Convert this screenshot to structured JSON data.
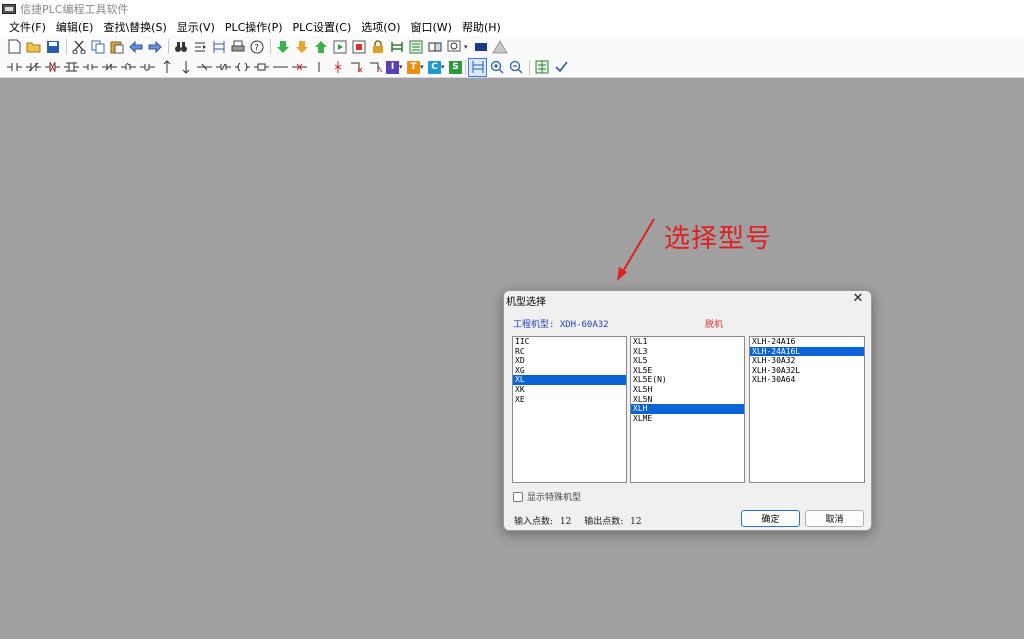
{
  "app": {
    "title": "信捷PLC编程工具软件"
  },
  "menu": {
    "items": [
      "文件(F)",
      "编辑(E)",
      "查找\\替换(S)",
      "显示(V)",
      "PLC操作(P)",
      "PLC设置(C)",
      "选项(O)",
      "窗口(W)",
      "帮助(H)"
    ]
  },
  "toolbar1": {
    "icons": [
      "new-file",
      "open-folder",
      "save",
      "cut",
      "copy",
      "paste",
      "undo-arrow",
      "redo-arrow",
      "binoculars",
      "replace",
      "ladder-table",
      "printer",
      "help",
      "download",
      "upload",
      "arrow-up",
      "run",
      "stop",
      "lock",
      "monitor",
      "sheet",
      "compare",
      "zoom-select",
      "screen",
      "warning"
    ]
  },
  "toolbar2": {
    "icons": [
      "contact-no",
      "contact-nc",
      "contact-neg",
      "contact-pos",
      "parallel-no",
      "parallel-nc",
      "parallel-pos",
      "parallel-neg",
      "arrow-up",
      "arrow-down",
      "horizontal-line",
      "contact-rising",
      "contact-falling",
      "coil-set",
      "coil",
      "line",
      "coil-neg",
      "vertical-line",
      "delete-line",
      "delete-branch",
      "insert-branch",
      "I",
      "T",
      "C",
      "S",
      "ladder-view",
      "zoom-in",
      "zoom-out",
      "monitor-table",
      "check"
    ],
    "box_letters": {
      "I": "I",
      "T": "T",
      "C": "C",
      "S": "S"
    }
  },
  "annotation": {
    "text": "选择型号"
  },
  "dialog": {
    "title": "机型选择",
    "close": "✕",
    "project_model_label": "工程机型:  XDH-60A32",
    "status": "脱机",
    "series": [
      "IIC",
      "RC",
      "XD",
      "XG",
      "XL",
      "XK",
      "XE"
    ],
    "series_selected": 4,
    "subseries": [
      "XL1",
      "XL3",
      "XL5",
      "XL5E",
      "XL5E(N)",
      "XL5H",
      "XL5N",
      "XLH",
      "XLME"
    ],
    "subseries_selected": 7,
    "models": [
      "XLH-24A16",
      "XLH-24A16L",
      "XLH-30A32",
      "XLH-30A32L",
      "XLH-30A64"
    ],
    "models_selected": 1,
    "special_checkbox_label": "显示特殊机型",
    "input_points_label": "输入点数:",
    "input_points_value": "12",
    "output_points_label": "输出点数:",
    "output_points_value": "12",
    "ok_label": "确定",
    "cancel_label": "取消"
  },
  "colors": {
    "selection": "#0a64d8",
    "annotation": "#e02020",
    "project_label": "#2540c0",
    "status": "#e03030",
    "workspace": "#a0a0a0"
  }
}
